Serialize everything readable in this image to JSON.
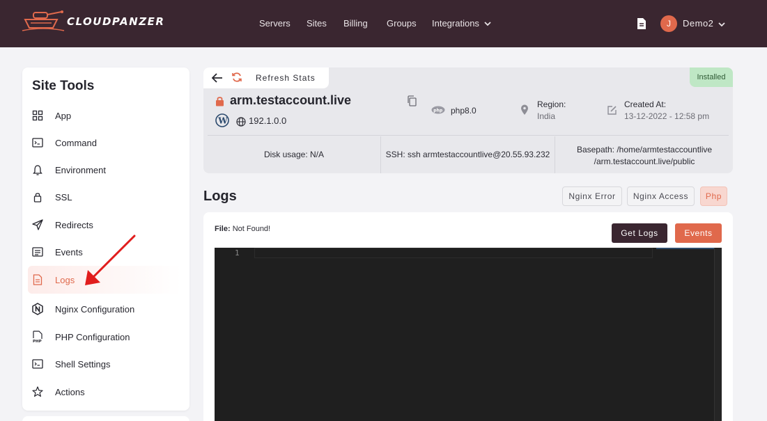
{
  "brand": {
    "name": "CLOUDPANZER",
    "accent": "#e0694c",
    "dark": "#3a2630"
  },
  "nav": {
    "items": [
      "Servers",
      "Sites",
      "Billing",
      "Groups",
      "Integrations"
    ]
  },
  "user": {
    "initial": "J",
    "name": "Demo2"
  },
  "sidebar": {
    "title": "Site Tools",
    "items": [
      {
        "label": "App",
        "icon": "grid-icon"
      },
      {
        "label": "Command",
        "icon": "terminal-icon"
      },
      {
        "label": "Environment",
        "icon": "bell-icon"
      },
      {
        "label": "SSL",
        "icon": "lock-icon"
      },
      {
        "label": "Redirects",
        "icon": "send-icon"
      },
      {
        "label": "Events",
        "icon": "list-icon"
      },
      {
        "label": "Logs",
        "icon": "file-icon",
        "active": true
      },
      {
        "label": "Nginx Configuration",
        "icon": "nginx-icon"
      },
      {
        "label": "PHP Configuration",
        "icon": "php-file-icon"
      },
      {
        "label": "Shell Settings",
        "icon": "terminal-icon"
      },
      {
        "label": "Actions",
        "icon": "star-icon"
      }
    ]
  },
  "site": {
    "refresh_label": "Refresh Stats",
    "status": "Installed",
    "name": "arm.testaccount.live",
    "ip": "192.1.0.0",
    "php": "php8.0",
    "region_label": "Region:",
    "region_value": "India",
    "created_label": "Created At:",
    "created_value": "13-12-2022 - 12:58 pm",
    "disk_label": "Disk usage:",
    "disk_value": "N/A",
    "ssh_label": "SSH:",
    "ssh_value": "ssh armtestaccountlive@20.55.93.232",
    "basepath_label": "Basepath:",
    "basepath_line1": "/home/armtestaccountlive",
    "basepath_line2": "/arm.testaccount.live/public"
  },
  "logs": {
    "title": "Logs",
    "tabs": [
      "Nginx Error",
      "Nginx Access",
      "Php"
    ],
    "active_tab": "Php",
    "file_label": "File:",
    "file_value": "Not Found!",
    "get_logs_label": "Get Logs",
    "events_label": "Events",
    "line_number": "1"
  }
}
